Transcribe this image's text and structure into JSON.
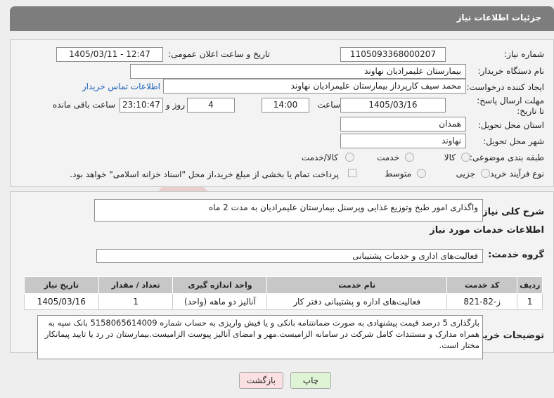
{
  "header": {
    "title": "جزئیات اطلاعات نیاز"
  },
  "fields": {
    "need_number_label": "شماره نیاز:",
    "need_number": "1105093368000207",
    "announce_label": "تاریخ و ساعت اعلان عمومی:",
    "announce_value": "1405/03/11 - 12:47",
    "buyer_label": "نام دستگاه خریدار:",
    "buyer_value": "بیمارستان علیمرادیان نهاوند",
    "creator_label": "ایجاد کننده درخواست:",
    "creator_value": "محمد سیف کارپرداز بیمارستان علیمرادیان نهاوند",
    "contact_link": "اطلاعات تماس خریدار",
    "deadline_label": "مهلت ارسال پاسخ: تا تاریخ:",
    "deadline_date": "1405/03/16",
    "time_label": "ساعت",
    "deadline_time": "14:00",
    "days_value": "4",
    "days_label": "روز و",
    "remaining_time": "23:10:47",
    "remaining_label": "ساعت باقی مانده",
    "province_label": "استان محل تحویل:",
    "province_value": "همدان",
    "city_label": "شهر محل تحویل:",
    "city_value": "نهاوند",
    "category_label": "طبقه بندی موضوعی:",
    "category_options": [
      "کالا",
      "خدمت",
      "کالا/خدمت"
    ],
    "category_selected": "خدمت",
    "process_label": "نوع فرآیند خرید :",
    "process_options": [
      "جزیی",
      "متوسط"
    ],
    "payment_note": "پرداخت تمام یا بخشی از مبلغ خرید،از محل \"اسناد خزانه اسلامی\" خواهد بود."
  },
  "summary": {
    "label": "شرح کلی نیاز:",
    "text": "واگذاری امور طبخ وتوزیع غذایی وپرسنل بیمارستان علیمرادیان به مدت 2 ماه"
  },
  "services": {
    "section_title": "اطلاعات خدمات مورد نیاز",
    "group_label": "گروه خدمت:",
    "group_value": "فعالیت‌های اداری و خدمات پشتیبانی",
    "columns": [
      "ردیف",
      "کد خدمت",
      "نام خدمت",
      "واحد اندازه گیری",
      "تعداد / مقدار",
      "تاریخ نیاز"
    ],
    "rows": [
      [
        "1",
        "ز-82-821",
        "فعالیت‌های اداره و پشتیبانی دفتر کار",
        "آنالیز دو ماهه (واحد)",
        "1",
        "1405/03/16"
      ]
    ]
  },
  "buyer_notes": {
    "label": "توضیحات خریدار:",
    "text": "بارگذاری 5 درصد قیمت پیشنهادی به صورت ضمانتنامه بانکی و یا فیش واریزی به حساب شماره 5158065614009 بانک سپه به همراه مدارک و مستندات کامل شرکت در سامانه الزامیست.مهر و امضای آنالیز پیوست الزامیست.بیمارستان در رد یا تایید پیمانکار مختار است."
  },
  "buttons": {
    "print": "چاپ",
    "back": "بازگشت"
  },
  "colors": {
    "header": "#7d7d7d",
    "link": "#1a5fb4",
    "print_btn": "#dff3d5",
    "back_btn": "#fbe0e2"
  }
}
